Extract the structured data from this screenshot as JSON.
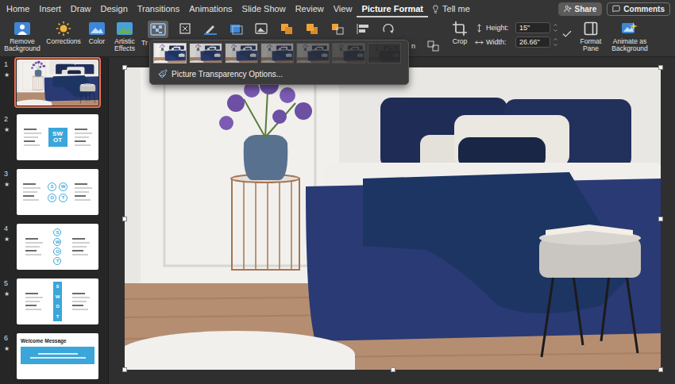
{
  "menu": {
    "tabs": [
      {
        "label": "Home",
        "selected": false
      },
      {
        "label": "Insert",
        "selected": false
      },
      {
        "label": "Draw",
        "selected": false
      },
      {
        "label": "Design",
        "selected": false
      },
      {
        "label": "Transitions",
        "selected": false
      },
      {
        "label": "Animations",
        "selected": false
      },
      {
        "label": "Slide Show",
        "selected": false
      },
      {
        "label": "Review",
        "selected": false
      },
      {
        "label": "View",
        "selected": false
      },
      {
        "label": "Picture Format",
        "selected": true
      }
    ],
    "tell_me": "Tell me",
    "buttons": [
      {
        "label": "Share",
        "kind": "filled"
      },
      {
        "label": "Comments",
        "kind": "outlined"
      }
    ]
  },
  "ribbon": {
    "buttons": [
      {
        "label": "Remove Background"
      },
      {
        "label": "Corrections"
      },
      {
        "label": "Color"
      },
      {
        "label": "Artistic Effects"
      }
    ],
    "transparency_button": {
      "label": "Tr",
      "pressed": true
    },
    "align_label": "n",
    "crop": "Crop",
    "size": [
      {
        "label": "Height:",
        "value": "15\""
      },
      {
        "label": "Width:",
        "value": "26.66\""
      }
    ],
    "right_buttons": [
      {
        "label": "Format Pane"
      },
      {
        "label": "Animate as Background"
      }
    ]
  },
  "transparency_menu": {
    "presets": [
      {
        "level": 0,
        "selected": true
      },
      {
        "level": 0.15,
        "selected": false
      },
      {
        "level": 0.3,
        "selected": false
      },
      {
        "level": 0.5,
        "selected": false
      },
      {
        "level": 0.65,
        "selected": false
      },
      {
        "level": 0.8,
        "selected": false
      },
      {
        "level": 0.95,
        "selected": false
      }
    ],
    "option": "Picture Transparency Options..."
  },
  "slides": [
    {
      "number": "1",
      "star": "★",
      "selected": true,
      "kind": "photo"
    },
    {
      "number": "2",
      "star": "★",
      "selected": false,
      "kind": "swot-box",
      "letters": [
        "SW",
        "OT"
      ]
    },
    {
      "number": "3",
      "star": "★",
      "selected": false,
      "kind": "swot-grid",
      "letters": [
        "S",
        "W",
        "O",
        "T"
      ]
    },
    {
      "number": "4",
      "star": "★",
      "selected": false,
      "kind": "swot-column",
      "letters": [
        "S",
        "W",
        "O",
        "T"
      ]
    },
    {
      "number": "5",
      "star": "★",
      "selected": false,
      "kind": "swot-bar",
      "letters": [
        "S",
        "W",
        "O",
        "T"
      ]
    },
    {
      "number": "6",
      "star": "★",
      "selected": false,
      "kind": "welcome",
      "title": "Welcome Message"
    }
  ]
}
